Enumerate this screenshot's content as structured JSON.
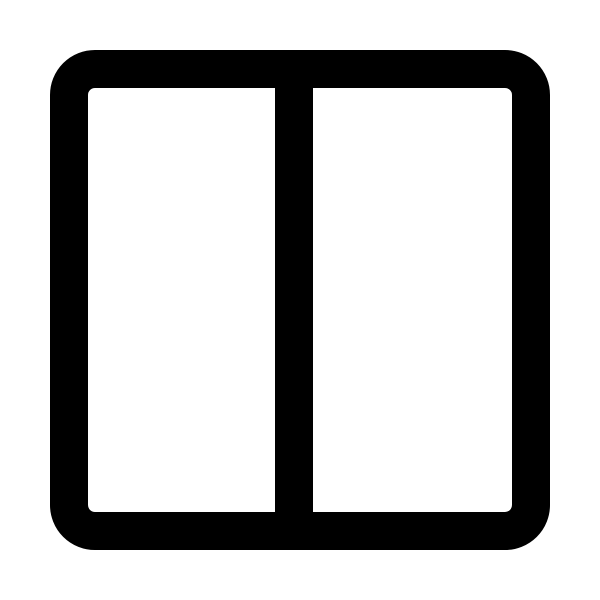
{
  "icon": {
    "name": "split-view-columns-icon",
    "stroke_color": "#000000",
    "fill_color": "#ffffff",
    "background": "#ffffff",
    "panels": 2
  }
}
